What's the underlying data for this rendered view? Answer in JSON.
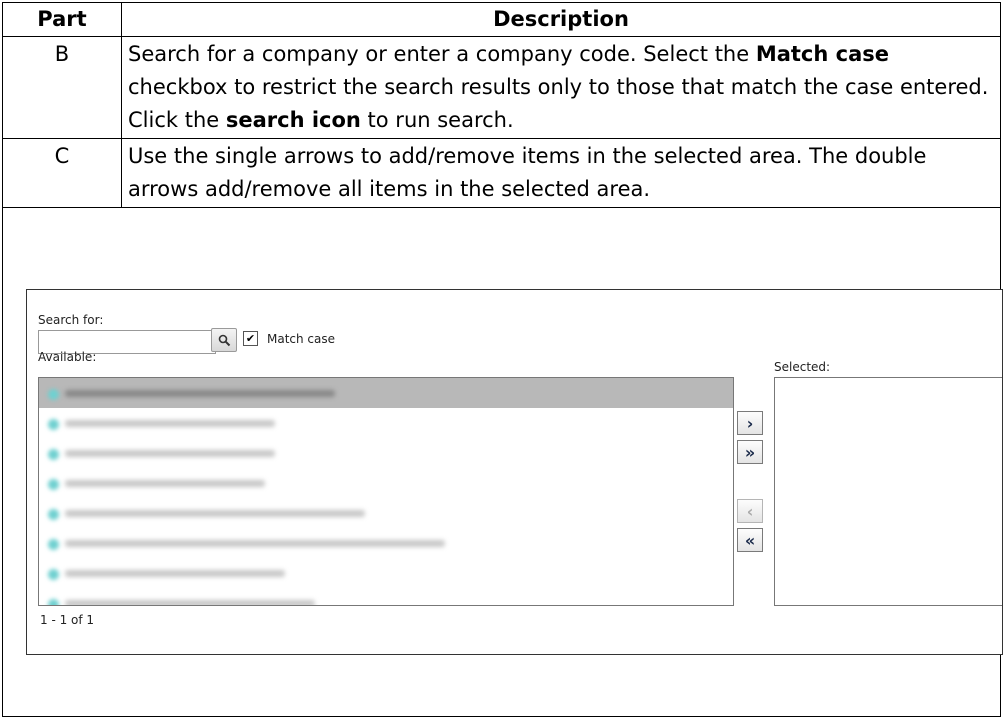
{
  "table": {
    "headers": {
      "part": "Part",
      "description": "Description"
    },
    "rows": [
      {
        "part": "B",
        "description": {
          "t1": "Search for a company or enter a company code. Select the ",
          "b1": "Match case",
          "t2": " checkbox to restrict the search results only to those that match the case entered. Click the ",
          "b2": "search icon",
          "t3": " to run search."
        }
      },
      {
        "part": "C",
        "description": {
          "t1": "Use the single arrows to add/remove items in the selected area. The double arrows add/remove all items in the selected area."
        }
      }
    ]
  },
  "screenshot": {
    "search_label": "Search for:",
    "search_value": "",
    "match_case_label": "Match case",
    "match_case_checked": true,
    "available_label": "Available:",
    "selected_label": "Selected:",
    "pager_text": "1 - 1 of 1",
    "buttons": {
      "add": "›",
      "add_all": "»",
      "remove": "‹",
      "remove_all": "«"
    },
    "icons": {
      "search": "search-icon",
      "item": "item-dot-icon"
    }
  }
}
